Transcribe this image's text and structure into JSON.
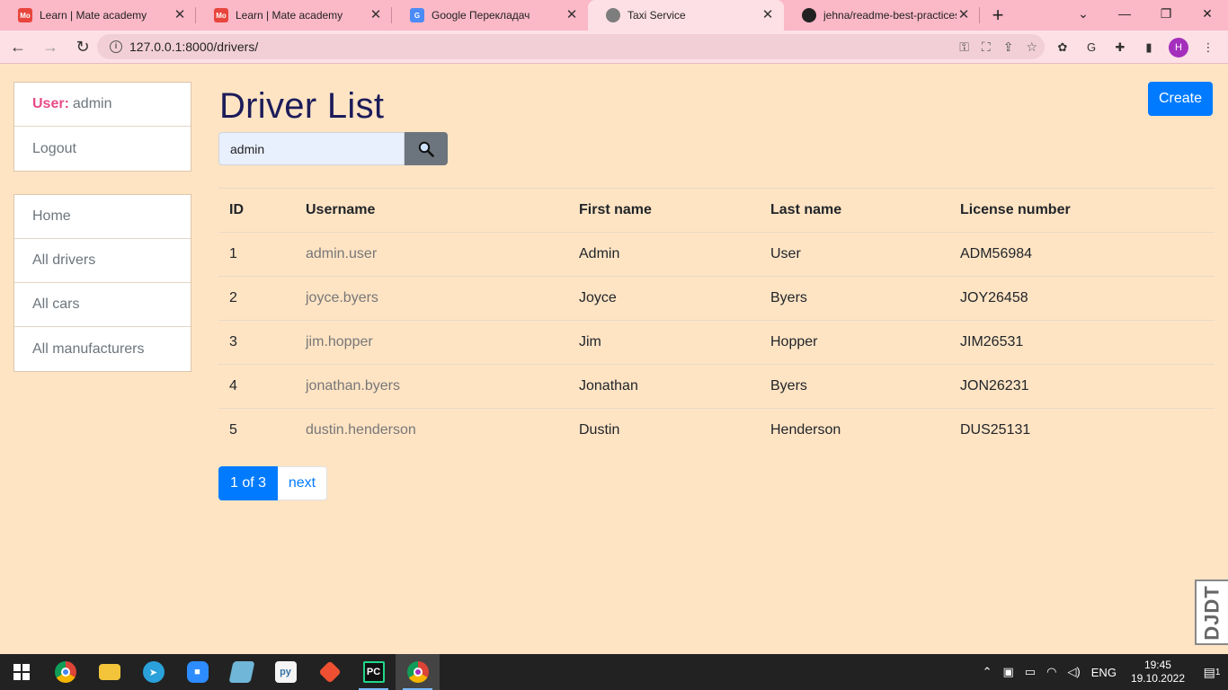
{
  "browser": {
    "tabs": [
      {
        "title": "Learn | Mate academy",
        "icon": "mate-academy-icon"
      },
      {
        "title": "Learn | Mate academy",
        "icon": "mate-academy-icon"
      },
      {
        "title": "Google Перекладач",
        "icon": "google-translate-icon"
      },
      {
        "title": "Taxi Service",
        "icon": "globe-icon"
      },
      {
        "title": "jehna/readme-best-practices",
        "icon": "github-icon"
      }
    ],
    "url": "127.0.0.1:8000/drivers/",
    "profile_initial": "H"
  },
  "sidebar": {
    "user_label": "User:",
    "username": "admin",
    "logout": "Logout",
    "nav": [
      "Home",
      "All drivers",
      "All cars",
      "All manufacturers"
    ]
  },
  "main": {
    "title": "Driver List",
    "create_label": "Create",
    "search_value": "admin",
    "table": {
      "headers": [
        "ID",
        "Username",
        "First name",
        "Last name",
        "License number"
      ],
      "rows": [
        [
          "1",
          "admin.user",
          "Admin",
          "User",
          "ADM56984"
        ],
        [
          "2",
          "joyce.byers",
          "Joyce",
          "Byers",
          "JOY26458"
        ],
        [
          "3",
          "jim.hopper",
          "Jim",
          "Hopper",
          "JIM26531"
        ],
        [
          "4",
          "jonathan.byers",
          "Jonathan",
          "Byers",
          "JON26231"
        ],
        [
          "5",
          "dustin.henderson",
          "Dustin",
          "Henderson",
          "DUS25131"
        ]
      ]
    },
    "pagination": {
      "current": "1 of 3",
      "next": "next"
    }
  },
  "debug_toolbar": "DJDT",
  "taskbar": {
    "language": "ENG",
    "time": "19:45",
    "date": "19.10.2022",
    "notification_count": "1"
  },
  "colors": {
    "page_bg": "#ffe4c4",
    "primary": "#007bff",
    "title": "#1c1c5a",
    "user_label": "#e64b88",
    "tab_strip": "#fbb8c7"
  }
}
